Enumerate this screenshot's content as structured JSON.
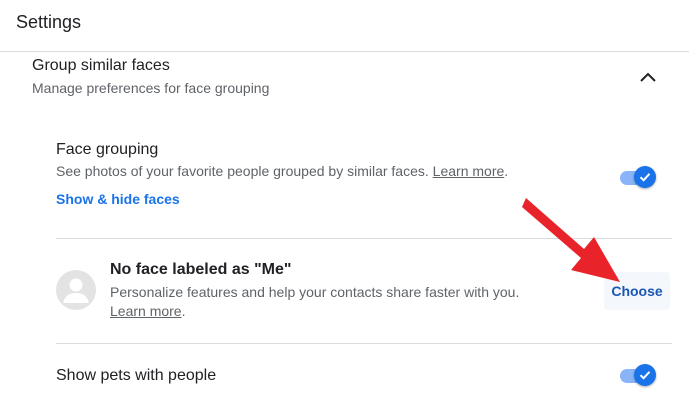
{
  "header": {
    "title": "Settings"
  },
  "section": {
    "title": "Group similar faces",
    "subtitle": "Manage preferences for face grouping"
  },
  "face_grouping": {
    "title": "Face grouping",
    "description": "See photos of your favorite people grouped by similar faces.",
    "learn_more": "Learn more",
    "trailing_period": ".",
    "show_hide": "Show & hide faces",
    "enabled": true
  },
  "me_label": {
    "title": "No face labeled as \"Me\"",
    "description": "Personalize features and help your contacts share faster with you.",
    "learn_more": "Learn more",
    "trailing_period": ".",
    "button": "Choose"
  },
  "pets": {
    "title": "Show pets with people",
    "enabled": true
  },
  "colors": {
    "accent": "#1a73e8",
    "toggle_track": "#8ab4f8",
    "annotation_arrow": "#e8232a"
  }
}
